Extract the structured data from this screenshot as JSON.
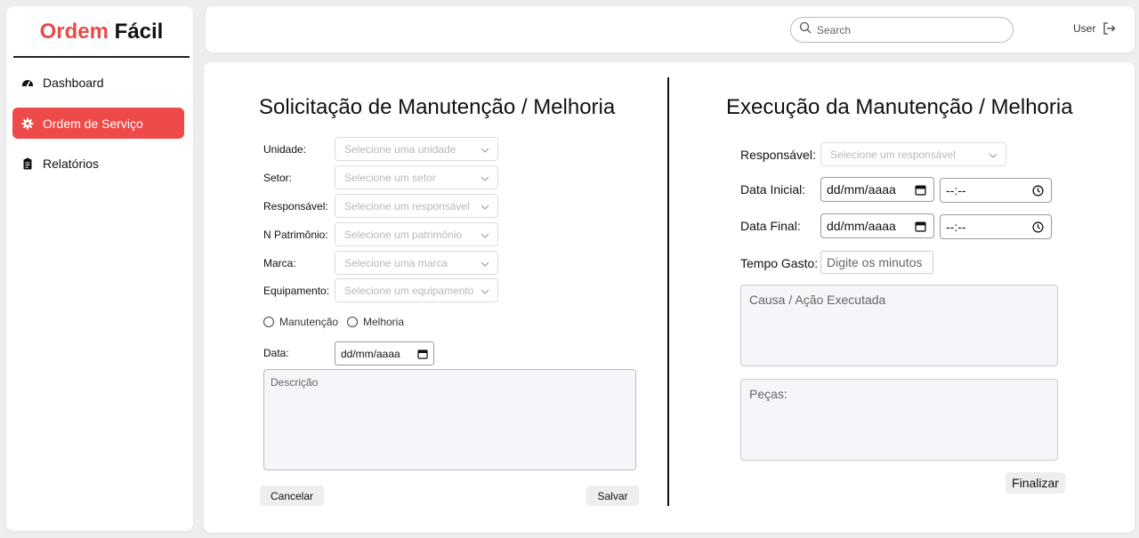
{
  "app": {
    "logo_part1": "Ordem",
    "logo_part2": "Fácil",
    "accent_color": "#ef4a4a"
  },
  "sidebar": {
    "items": [
      {
        "label": "Dashboard",
        "icon": "gauge-icon",
        "active": false
      },
      {
        "label": "Ordem de Serviço",
        "icon": "gear-icon",
        "active": true
      },
      {
        "label": "Relatórios",
        "icon": "clipboard-icon",
        "active": false
      }
    ]
  },
  "topbar": {
    "search_placeholder": "Search",
    "user_label": "User"
  },
  "request": {
    "title": "Solicitação de Manutenção / Melhoria",
    "fields": [
      {
        "label": "Unidade:",
        "placeholder": "Selecione uma unidade"
      },
      {
        "label": "Setor:",
        "placeholder": "Selecione um setor"
      },
      {
        "label": "Responsável:",
        "placeholder": "Selecione um responsável"
      },
      {
        "label": "N Patrimônio:",
        "placeholder": "Selecione um patrimônio"
      },
      {
        "label": "Marca:",
        "placeholder": "Selecione uma marca"
      },
      {
        "label": "Equipamento:",
        "placeholder": "Selecione um equipamento"
      }
    ],
    "radio_options": [
      "Manutenção",
      "Melhoria"
    ],
    "date_label": "Data:",
    "date_value": "dd/mm/aaaa",
    "description_placeholder": "Descrição",
    "cancel_label": "Cancelar",
    "save_label": "Salvar"
  },
  "execution": {
    "title": "Execução da Manutenção / Melhoria",
    "responsible_label": "Responsável:",
    "responsible_placeholder": "Selecione um responsável",
    "start_label": "Data Inicial:",
    "end_label": "Data Final:",
    "date_value": "dd/mm/aaaa",
    "time_value": "--:--",
    "time_spent_label": "Tempo Gasto:",
    "time_spent_placeholder": "Digite os minutos",
    "cause_placeholder": "Causa / Ação Executada",
    "parts_placeholder": "Peças:",
    "finish_label": "Finalizar"
  }
}
